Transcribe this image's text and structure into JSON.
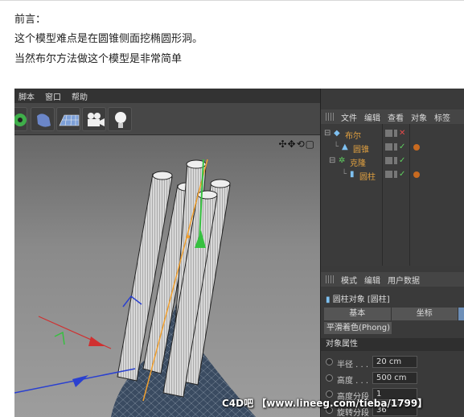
{
  "intro": {
    "title": "前言：",
    "line1": "这个模型难点是在圆锥侧面挖椭圆形洞。",
    "line2": "当然布尔方法做这个模型是非常简单"
  },
  "c4d": {
    "menu": [
      "脚本",
      "窗口",
      "帮助"
    ],
    "toolbar_icons": [
      "cloner-icon",
      "deformer-icon",
      "floor-icon",
      "camera-icon",
      "light-icon"
    ],
    "object_manager": {
      "menu": [
        "文件",
        "编辑",
        "查看",
        "对象",
        "标签"
      ],
      "tree": [
        {
          "name": "布尔",
          "visible": false
        },
        {
          "name": "圆锥",
          "visible": true
        },
        {
          "name": "克隆",
          "visible": true
        },
        {
          "name": "圆柱",
          "visible": true
        }
      ]
    },
    "attribute_manager": {
      "menu": [
        "模式",
        "编辑",
        "用户数据"
      ],
      "object_title": "圆柱对象 [圆柱]",
      "tabs": [
        "基本",
        "坐标"
      ],
      "phong_tab": "平滑着色(Phong)",
      "section": "对象属性",
      "fields": [
        {
          "label": "半径 . . .",
          "value": "20 cm"
        },
        {
          "label": "高度 . . .",
          "value": "500 cm"
        },
        {
          "label": "高度分段",
          "value": "1"
        },
        {
          "label": "旋转分段",
          "value": "36"
        }
      ]
    },
    "watermark": "C4D吧 【www.lineeg.com/tieba/1799】",
    "colors": {
      "accent": "#6d8fb8",
      "object_name": "#e0a040"
    }
  }
}
